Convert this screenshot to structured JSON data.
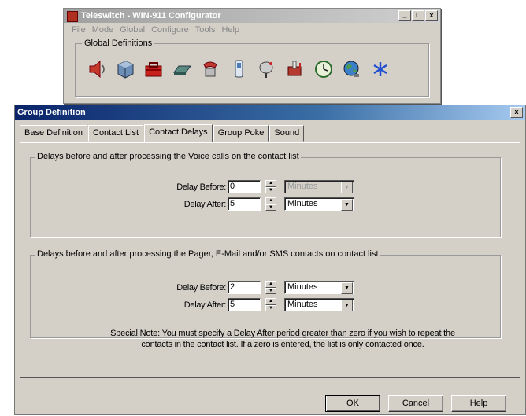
{
  "back_window": {
    "title": "Teleswitch - WIN-911 Configurator",
    "menu": [
      "File",
      "Mode",
      "Global",
      "Configure",
      "Tools",
      "Help"
    ],
    "title_buttons": [
      "_",
      "□",
      "x"
    ],
    "group_label": "Global Definitions",
    "icons": [
      "speaker-icon",
      "cube-icon",
      "toolbox-icon",
      "modem-icon",
      "phone-icon",
      "pager-icon",
      "satellite-dish-icon",
      "mailbox-icon",
      "clock-icon",
      "globe-icon",
      "star-icon"
    ]
  },
  "dialog": {
    "title": "Group Definition",
    "close_label": "x",
    "tabs": [
      "Base Definition",
      "Contact List",
      "Contact Delays",
      "Group Poke",
      "Sound"
    ],
    "active_tab": "Contact Delays",
    "voice_group": {
      "label": "Delays before and after processing the Voice calls on the contact list",
      "before_label": "Delay Before:",
      "before_value": "0",
      "before_unit": "Minutes",
      "after_label": "Delay After:",
      "after_value": "5",
      "after_unit": "Minutes"
    },
    "pager_group": {
      "label": "Delays before and after processing the Pager, E-Mail and/or SMS contacts on contact list",
      "before_label": "Delay Before:",
      "before_value": "2",
      "before_unit": "Minutes",
      "after_label": "Delay After:",
      "after_value": "5",
      "after_unit": "Minutes"
    },
    "note_line1": "Special Note:  You must specify a Delay After period greater than zero if you wish to repeat the",
    "note_line2": "contacts in the contact list. If a zero is entered, the list is only contacted once.",
    "buttons": {
      "ok": "OK",
      "cancel": "Cancel",
      "help": "Help"
    }
  },
  "colors": {
    "face": "#d4d0c8",
    "title_active": "#0a246a",
    "title_inactive": "#a0a0a0"
  }
}
